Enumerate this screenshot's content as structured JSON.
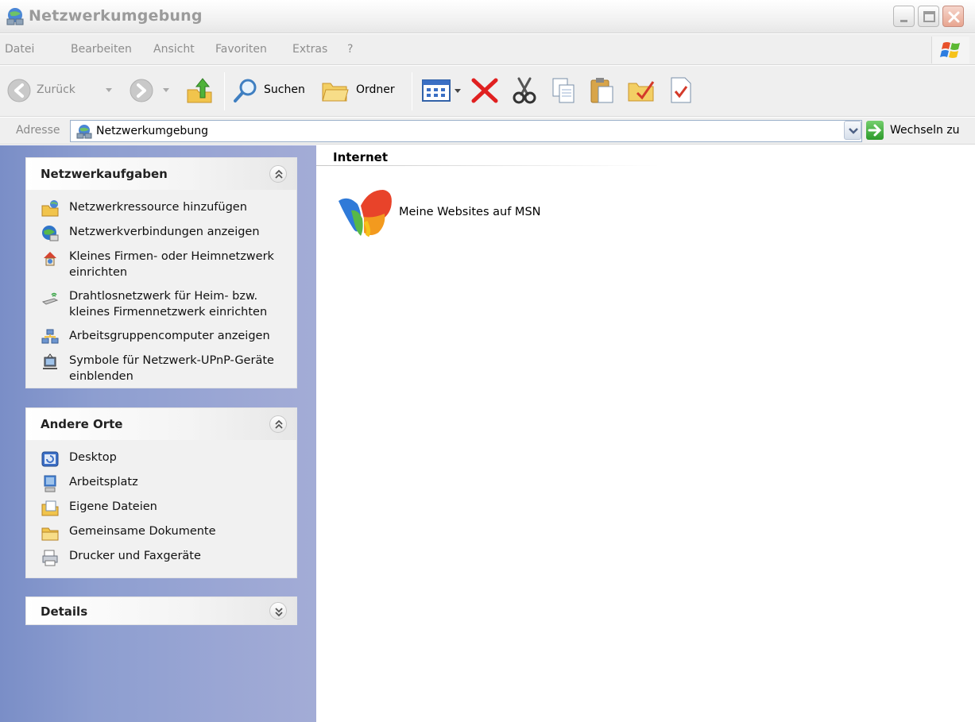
{
  "window": {
    "title": "Netzwerkumgebung"
  },
  "menu": {
    "items": [
      "Datei",
      "Bearbeiten",
      "Ansicht",
      "Favoriten",
      "Extras",
      "?"
    ]
  },
  "toolbar": {
    "back_label": "Zurück",
    "search_label": "Suchen",
    "folders_label": "Ordner"
  },
  "address": {
    "label": "Adresse",
    "value": "Netzwerkumgebung",
    "go_label": "Wechseln zu"
  },
  "tasks": {
    "title": "Netzwerkaufgaben",
    "items": [
      {
        "label": "Netzwerkressource hinzufügen",
        "icon": "add-network-place-icon"
      },
      {
        "label": "Netzwerkverbindungen anzeigen",
        "icon": "network-connections-icon"
      },
      {
        "label": "Kleines Firmen- oder Heimnetzwerk einrichten",
        "icon": "home-network-icon"
      },
      {
        "label": "Drahtlosnetzwerk für Heim- bzw. kleines Firmennetzwerk einrichten",
        "icon": "wireless-network-icon"
      },
      {
        "label": "Arbeitsgruppencomputer anzeigen",
        "icon": "workgroup-computers-icon"
      },
      {
        "label": "Symbole für Netzwerk-UPnP-Geräte einblenden",
        "icon": "upnp-devices-icon"
      }
    ]
  },
  "places": {
    "title": "Andere Orte",
    "items": [
      {
        "label": "Desktop",
        "icon": "desktop-icon"
      },
      {
        "label": "Arbeitsplatz",
        "icon": "my-computer-icon"
      },
      {
        "label": "Eigene Dateien",
        "icon": "my-documents-icon"
      },
      {
        "label": "Gemeinsame Dokumente",
        "icon": "shared-documents-folder-icon"
      },
      {
        "label": "Drucker und Faxgeräte",
        "icon": "printers-faxes-icon"
      }
    ]
  },
  "details": {
    "title": "Details"
  },
  "content": {
    "group_title": "Internet",
    "items": [
      {
        "label": "Meine Websites auf MSN",
        "icon": "msn-butterfly-icon"
      }
    ]
  },
  "colors": {
    "taskpane_start": "#7a8ec7",
    "taskpane_end": "#a3acd6",
    "close_red": "#e8a590",
    "delete_red": "#e02020",
    "go_green": "#2d9a2b"
  }
}
